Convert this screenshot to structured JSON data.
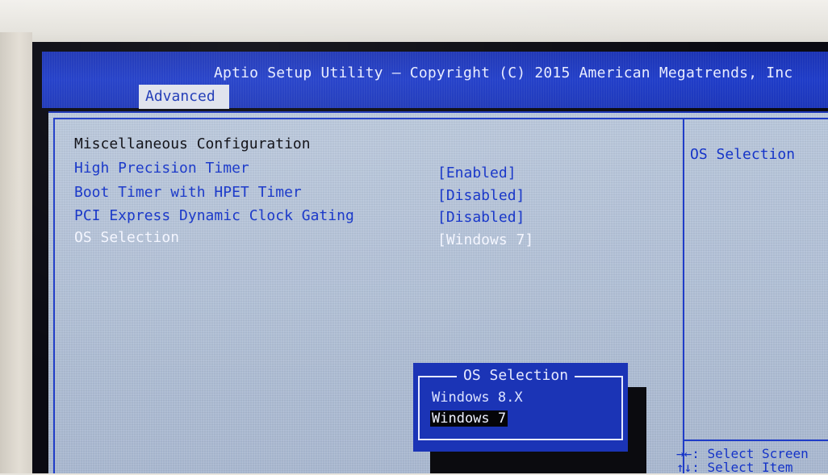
{
  "header": {
    "title": "Aptio Setup Utility – Copyright (C) 2015 American Megatrends, Inc",
    "active_tab": "Advanced"
  },
  "main": {
    "section_title": "Miscellaneous Configuration",
    "items": [
      {
        "label": "High Precision Timer",
        "value": "[Enabled]"
      },
      {
        "label": "Boot Timer with HPET Timer",
        "value": "[Disabled]"
      },
      {
        "label": "PCI Express Dynamic Clock Gating",
        "value": "[Disabled]"
      },
      {
        "label": "OS Selection",
        "value": "[Windows 7]"
      }
    ]
  },
  "help": {
    "text": "OS Selection",
    "hints": [
      {
        "key": "→←:",
        "text": "Select Screen"
      },
      {
        "key": "↑↓:",
        "text": "Select Item"
      }
    ]
  },
  "popup": {
    "title": "OS Selection",
    "options": [
      "Windows 8.X",
      "Windows 7"
    ],
    "selected": "Windows 7"
  }
}
